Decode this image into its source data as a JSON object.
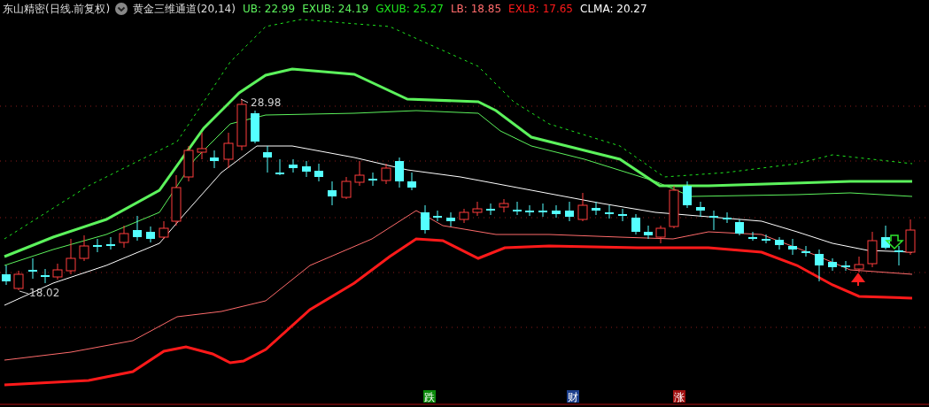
{
  "header": {
    "title": "东山精密(日线.前复权)",
    "indicator": "黄金三维通道(20,14)",
    "legend": [
      {
        "text": "UB: 22.99",
        "color": "#5cf25c"
      },
      {
        "text": "EXUB: 24.19",
        "color": "#5cf25c"
      },
      {
        "text": "GXUB: 25.27",
        "color": "#1ee61e"
      },
      {
        "text": "LB: 18.85",
        "color": "#ff6b6b"
      },
      {
        "text": "EXLB: 17.65",
        "color": "#ff1a1a"
      },
      {
        "text": "CLMA: 20.27",
        "color": "#ffffff"
      }
    ]
  },
  "chart": {
    "high_label": "28.98",
    "low_label": "18.02"
  },
  "markers": [
    {
      "text": "跌",
      "kind": "fall"
    },
    {
      "text": "财",
      "kind": "finance"
    },
    {
      "text": "涨",
      "kind": "rise"
    }
  ]
}
